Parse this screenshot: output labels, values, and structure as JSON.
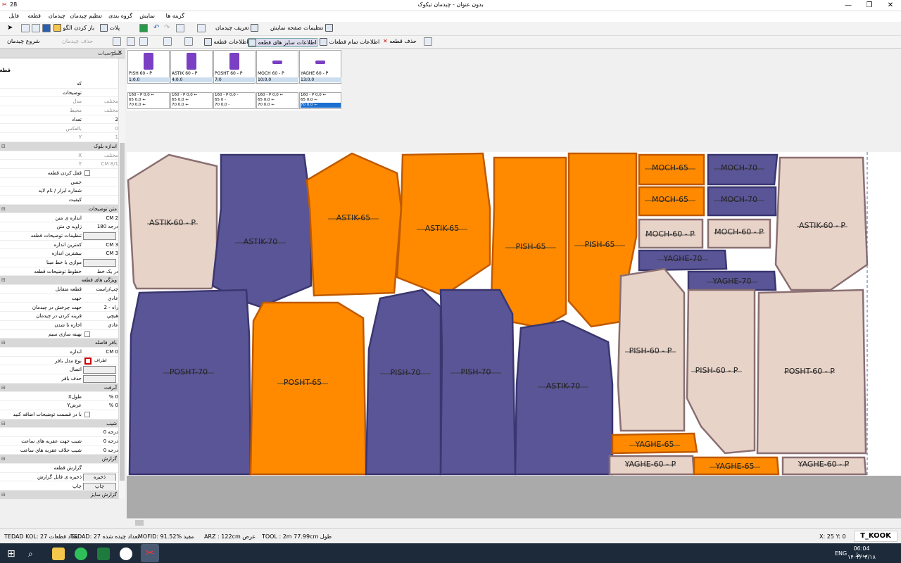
{
  "window": {
    "title": "بدون عنوان - چیدمان تیکوک",
    "badge": "28"
  },
  "menu": [
    "فایل",
    "قطعه",
    "چیدمان",
    "تنظیم چیدمان",
    "گروه بندی",
    "نمایش",
    "گزینه ها"
  ],
  "toolbar1": {
    "open_pattern": "باز کردن الگو",
    "plots": "پلات",
    "define_layout": "تعریف چیدمان",
    "page_display_settings": "تنظیمات صفحه نمایش"
  },
  "toolbar2": {
    "start_layout": "شروع چیدمان",
    "layout_clear": "حذف چیدمان",
    "piece_info": "اطلاعات قطعه",
    "size_info": "اطلاعات سایز های قطعه",
    "all_pieces_info": "اطلاعات تمام قطعات",
    "delete_piece": "حذف قطعه"
  },
  "properties": {
    "title": "خصوصیات",
    "section": "قطعه",
    "rows": [
      {
        "label": "کد",
        "value": "",
        "type": "text"
      },
      {
        "label": "توضیحات",
        "value": "",
        "type": "text"
      },
      {
        "label": "مدل",
        "value": "مختلف",
        "type": "text",
        "dim": true
      },
      {
        "label": "محیط",
        "value": "مختلف",
        "type": "text",
        "dim": true
      },
      {
        "label": "تعداد",
        "value": "2",
        "type": "text"
      },
      {
        "label": "بالعکس",
        "value": "0",
        "type": "text",
        "dim": true
      },
      {
        "label": "Y",
        "value": "1",
        "type": "text",
        "dim": true
      },
      {
        "label": "اندازه بلوک",
        "value": "",
        "type": "cat"
      },
      {
        "label": "X",
        "value": "مختلف",
        "type": "text",
        "dim": true
      },
      {
        "label": "Y",
        "value": "8/1 CM",
        "type": "text",
        "dim": true
      },
      {
        "label": "قفل کردن قطعه",
        "value": "",
        "type": "check"
      },
      {
        "label": "جنس",
        "value": "",
        "type": "text"
      },
      {
        "label": "شماره ابزار / نام لایه",
        "value": "",
        "type": "text"
      },
      {
        "label": "کیفیت",
        "value": "",
        "type": "text"
      },
      {
        "label": "متن توضیحات",
        "value": "",
        "type": "cat"
      },
      {
        "label": "اندازه ی متن",
        "value": "2 CM",
        "type": "text"
      },
      {
        "label": "زاویه ی متن",
        "value": "درجه 180",
        "type": "text"
      },
      {
        "label": "تنظیمات توضیحات قطعه",
        "value": "",
        "type": "button"
      },
      {
        "label": "کمترین اندازه",
        "value": "3 CM",
        "type": "text"
      },
      {
        "label": "بیشترین اندازه",
        "value": "3 CM",
        "type": "text"
      },
      {
        "label": "موازی با خط مبنا",
        "value": "",
        "type": "button"
      },
      {
        "label": "خطوط توضیحات قطعه",
        "value": "در یک خط",
        "type": "text"
      },
      {
        "label": "ویژگی های قطعه",
        "value": "",
        "type": "cat"
      },
      {
        "label": "قطعه متقابل",
        "value": "چپ/راست",
        "type": "text"
      },
      {
        "label": "جهت",
        "value": "عادي",
        "type": "text"
      },
      {
        "label": "جهت چرخش در چیدمان",
        "value": "راه - 2",
        "type": "text"
      },
      {
        "label": "قرینه کردن در چیدمان",
        "value": "هیچي",
        "type": "text"
      },
      {
        "label": "اجازه تا شدن",
        "value": "عادي",
        "type": "text"
      },
      {
        "label": "بهینه سازی سیم",
        "value": "",
        "type": "check"
      },
      {
        "label": "بافر فاصله",
        "value": "",
        "type": "cat"
      },
      {
        "label": "اندازه",
        "value": "0 CM",
        "type": "text"
      },
      {
        "label": "نوع مدل بافر",
        "value": "اطراف",
        "type": "checkred"
      },
      {
        "label": "اتصال",
        "value": "",
        "type": "button"
      },
      {
        "label": "حذف بافر",
        "value": "",
        "type": "button"
      },
      {
        "label": "آبرفت",
        "value": "",
        "type": "cat"
      },
      {
        "label": "طولX",
        "value": "0 %",
        "type": "text"
      },
      {
        "label": "عرضY",
        "value": "0 %",
        "type": "text"
      },
      {
        "label": "با در قسمت توضیحات اضافه کنید",
        "value": "",
        "type": "check"
      },
      {
        "label": "شیب",
        "value": "",
        "type": "cat"
      },
      {
        "label": "",
        "value": "درجه 0",
        "type": "text"
      },
      {
        "label": "شیب جهت عقربه های ساعت",
        "value": "درجه 0",
        "type": "text"
      },
      {
        "label": "شیب خلاف عقربه های ساعت",
        "value": "درجه 0",
        "type": "text"
      },
      {
        "label": "گزارش",
        "value": "",
        "type": "cat"
      },
      {
        "label": "گزارش قطعه",
        "value": "",
        "type": "text"
      },
      {
        "label": "ذخیره ی فایل گزارش",
        "value": "ذخیره",
        "type": "button"
      },
      {
        "label": "چاپ",
        "value": "چاپ",
        "type": "button"
      },
      {
        "label": "گزارش سایز",
        "value": "",
        "type": "cat"
      }
    ]
  },
  "pieces_bar": [
    {
      "name": "PISH 60 - P",
      "count": "1:0.0",
      "color": "#7a3fc2"
    },
    {
      "name": "ASTIK 60 - P",
      "count": "4:0.0",
      "color": "#7a3fc2"
    },
    {
      "name": "POSHT 60 - P",
      "count": "7:0",
      "color": "#7a3fc2"
    },
    {
      "name": "MOCH 60 - P",
      "count": "10:0.0",
      "color": "#7a3fc2"
    },
    {
      "name": "YAGHE 60 - P",
      "count": "13:0.0",
      "color": "#7a3fc2"
    }
  ],
  "sizes_grid": [
    [
      "160 - P 0,0 ←",
      "65  0,0 ←",
      "70  0,0 ←"
    ],
    [
      "160 - P 0,0 ←",
      "65  0,0 ←",
      "70  0,0 ←"
    ],
    [
      "160 - P 0,0  -",
      "65  0  -",
      "70  0,0  -"
    ],
    [
      "160 - P 0,0 ←",
      "65  0,0 ←",
      "70  0,0 ←"
    ],
    [
      "160 - P 0,0 ←",
      "65  0,0 ←",
      "70  0,0 ←"
    ]
  ],
  "colors": {
    "orange": "#ff8a00",
    "purple": "#5a5596",
    "beige": "#e8d3c8"
  },
  "pieces": [
    {
      "label": "ASTIK-60 - P",
      "fill": "#e8d3c8"
    },
    {
      "label": "ASTIK-70",
      "fill": "#5a5596"
    },
    {
      "label": "ASTIK-65",
      "fill": "#ff8a00"
    },
    {
      "label": "ASTIK-65",
      "fill": "#ff8a00"
    },
    {
      "label": "PISH-65",
      "fill": "#ff8a00"
    },
    {
      "label": "PISH-65",
      "fill": "#ff8a00"
    },
    {
      "label": "MOCH-65",
      "fill": "#ff8a00"
    },
    {
      "label": "MOCH-70",
      "fill": "#5a5596"
    },
    {
      "label": "MOCH-65",
      "fill": "#ff8a00"
    },
    {
      "label": "MOCH-70",
      "fill": "#5a5596"
    },
    {
      "label": "MOCH-60 - P",
      "fill": "#e8d3c8"
    },
    {
      "label": "MOCH-60 - P",
      "fill": "#e8d3c8"
    },
    {
      "label": "YAGHE-70",
      "fill": "#5a5596"
    },
    {
      "label": "YAGHE-70",
      "fill": "#5a5596"
    },
    {
      "label": "ASTIK-60 - P",
      "fill": "#e8d3c8"
    },
    {
      "label": "POSHT-70",
      "fill": "#5a5596"
    },
    {
      "label": "POSHT-65",
      "fill": "#ff8a00"
    },
    {
      "label": "PISH-70",
      "fill": "#5a5596"
    },
    {
      "label": "PISH-70",
      "fill": "#5a5596"
    },
    {
      "label": "ASTIK-70",
      "fill": "#5a5596"
    },
    {
      "label": "PISH-60 - P",
      "fill": "#e8d3c8"
    },
    {
      "label": "PISH-60 - P",
      "fill": "#e8d3c8"
    },
    {
      "label": "POSHT-60 - P",
      "fill": "#e8d3c8"
    },
    {
      "label": "YAGHE-65",
      "fill": "#ff8a00"
    },
    {
      "label": "YAGHE-60 - P",
      "fill": "#e8d3c8"
    },
    {
      "label": "YAGHE-65",
      "fill": "#ff8a00"
    },
    {
      "label": "YAGHE-60 - P",
      "fill": "#e8d3c8"
    }
  ],
  "status": {
    "total_pieces": "TEDAD KOL: 27 تعداد قطعات",
    "placed_pieces": "TEDAD: 27 تعداد چیده شده",
    "efficiency": "MOFID: 91.52% مفید",
    "width": "ARZ : 122cm عرض",
    "length": "TOOL : 2m 77.99cm طول",
    "coords": "X: 25   Y: 0",
    "brand": "T_KOOK"
  },
  "taskbar": {
    "lang": "ENG",
    "time": "06:04 ب.ظ",
    "date": "۱۴۰۲/۰۴/۱۸"
  }
}
